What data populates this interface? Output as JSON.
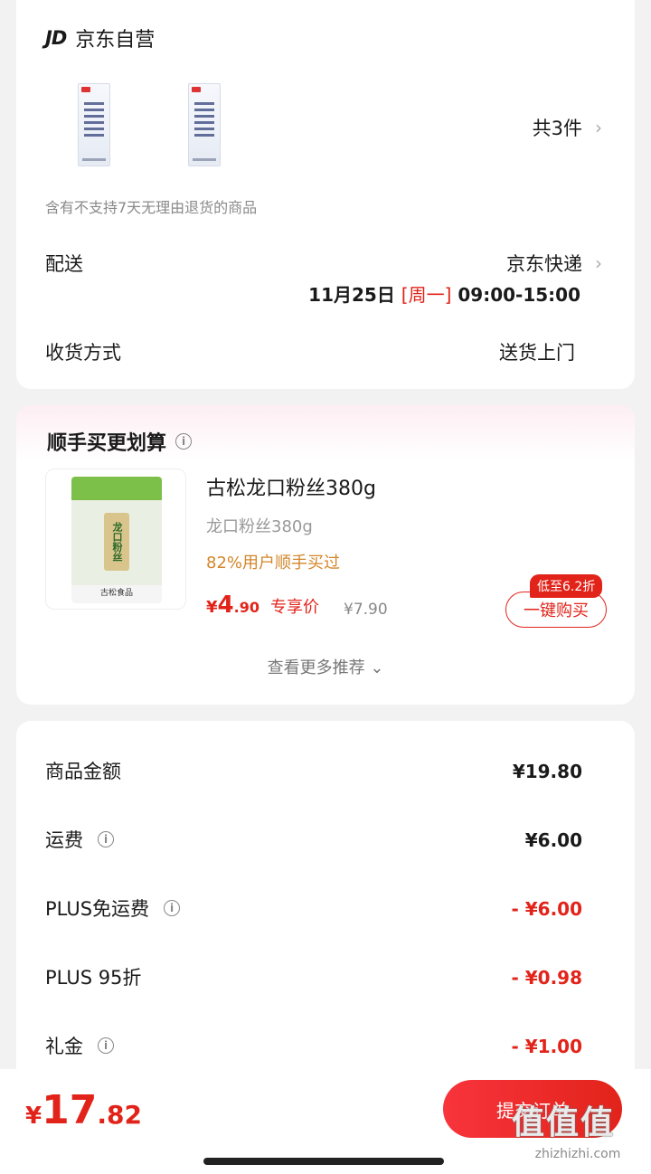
{
  "store": {
    "logo": "JD",
    "name": "京东自营",
    "item_count": "共3件",
    "return_note": "含有不支持7天无理由退货的商品",
    "delivery_label": "配送",
    "delivery_value": "京东快递",
    "delivery_date": "11月25日",
    "delivery_weekday": "[周一]",
    "delivery_window": "09:00-15:00",
    "receive_label": "收货方式",
    "receive_value": "送货上门"
  },
  "recommend": {
    "title": "顺手买更划算",
    "product_name": "古松龙口粉丝380g",
    "product_sub": "龙口粉丝380g",
    "bought_note": "82%用户顺手买过",
    "price_currency": "¥",
    "price_int": "4",
    "price_dec": ".90",
    "price_tag": "专享价",
    "orig_price": "¥7.90",
    "discount_badge": "低至6.2折",
    "buy_button": "一键购买",
    "more_link": "查看更多推荐 ⌄",
    "package_label": "龙口粉丝",
    "package_brand": "古松食品"
  },
  "summary": {
    "rows": [
      {
        "label": "商品金额",
        "value": "¥19.80"
      },
      {
        "label": "运费",
        "value": "¥6.00"
      },
      {
        "label": "PLUS免运费",
        "value": "- ¥6.00"
      },
      {
        "label": "PLUS 95折",
        "value": "- ¥0.98"
      },
      {
        "label": "礼金",
        "value": "- ¥1.00"
      }
    ]
  },
  "bottom": {
    "total_currency": "¥",
    "total_int": "17",
    "total_dec": ".82",
    "submit_button": "提交订单"
  },
  "watermark": {
    "glyphs": "值值值",
    "url": "zhizhizhi.com"
  },
  "colors": {
    "accent": "#e2231a",
    "bought_note": "#d4862a"
  },
  "icons": {
    "info": "info-icon",
    "chevron": "chevron-right-icon"
  }
}
